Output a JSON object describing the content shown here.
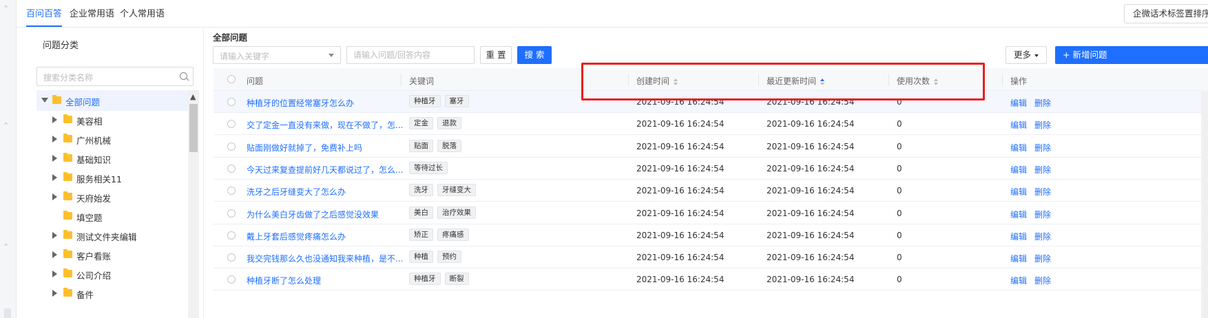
{
  "top_tabs": [
    {
      "label": "百问百答",
      "active": true
    },
    {
      "label": "企业常用语",
      "active": false
    },
    {
      "label": "个人常用语",
      "active": false
    }
  ],
  "sort_button": "企微话术标签置排序",
  "sidebar": {
    "title": "问题分类",
    "search_placeholder": "搜索分类名称",
    "tree": [
      {
        "label": "全部问题",
        "level": 0,
        "expanded": true,
        "arrow": true
      },
      {
        "label": "美容相",
        "level": 1,
        "arrow": true
      },
      {
        "label": "广州机械",
        "level": 1,
        "arrow": true
      },
      {
        "label": "基础知识",
        "level": 1,
        "arrow": true
      },
      {
        "label": "服务相关11",
        "level": 1,
        "arrow": true
      },
      {
        "label": "天府始发",
        "level": 1,
        "arrow": true
      },
      {
        "label": "填空题",
        "level": 1,
        "arrow": false
      },
      {
        "label": "测试文件夹编辑",
        "level": 1,
        "arrow": true
      },
      {
        "label": "客户看账",
        "level": 1,
        "arrow": true
      },
      {
        "label": "公司介绍",
        "level": 1,
        "arrow": true
      },
      {
        "label": "备件",
        "level": 1,
        "arrow": true
      }
    ]
  },
  "main": {
    "title": "全部问题",
    "keyword_placeholder": "请输入关键字",
    "question_placeholder": "请输入问题/回答内容",
    "reset_label": "重 置",
    "search_label": "搜 索",
    "more_label": "更多",
    "add_label": "+ 新增问题"
  },
  "table": {
    "headers": {
      "question": "问题",
      "keywords": "关键词",
      "created": "创建时间",
      "updated": "最近更新时间",
      "usage": "使用次数",
      "ops": "操作"
    },
    "edit_label": "编辑",
    "delete_label": "删除",
    "rows": [
      {
        "question": "种植牙的位置经常塞牙怎么办",
        "tags": [
          "种植牙",
          "塞牙"
        ],
        "created": "2021-09-16 16:24:54",
        "updated": "2021-09-16 16:24:54",
        "usage": "0"
      },
      {
        "question": "交了定金一直没有来做，现在不做了，怎...",
        "tags": [
          "定金",
          "退款"
        ],
        "created": "2021-09-16 16:24:54",
        "updated": "2021-09-16 16:24:54",
        "usage": "0"
      },
      {
        "question": "贴面刚做好就掉了，免费补上吗",
        "tags": [
          "贴面",
          "脱落"
        ],
        "created": "2021-09-16 16:24:54",
        "updated": "2021-09-16 16:24:54",
        "usage": "0"
      },
      {
        "question": "今天过来复查提前好几天都说过了，怎么...",
        "tags": [
          "等待过长"
        ],
        "created": "2021-09-16 16:24:54",
        "updated": "2021-09-16 16:24:54",
        "usage": "0"
      },
      {
        "question": "洗牙之后牙缝变大了怎么办",
        "tags": [
          "洗牙",
          "牙缝变大"
        ],
        "created": "2021-09-16 16:24:54",
        "updated": "2021-09-16 16:24:54",
        "usage": "0"
      },
      {
        "question": "为什么美白牙齿做了之后感觉没效果",
        "tags": [
          "美白",
          "治疗效果"
        ],
        "created": "2021-09-16 16:24:54",
        "updated": "2021-09-16 16:24:54",
        "usage": "0"
      },
      {
        "question": "戴上牙套后感觉疼痛怎么办",
        "tags": [
          "矫正",
          "疼痛感"
        ],
        "created": "2021-09-16 16:24:54",
        "updated": "2021-09-16 16:24:54",
        "usage": "0"
      },
      {
        "question": "我交完钱那么久也没通知我来种植，是不...",
        "tags": [
          "种植",
          "预约"
        ],
        "created": "2021-09-16 16:24:54",
        "updated": "2021-09-16 16:24:54",
        "usage": "0"
      },
      {
        "question": "种植牙断了怎么处理",
        "tags": [
          "种植牙",
          "断裂"
        ],
        "created": "2021-09-16 16:24:54",
        "updated": "2021-09-16 16:24:54",
        "usage": "0"
      }
    ]
  },
  "colors": {
    "accent": "#1f6fff",
    "highlight_box": "#ea1c1c",
    "folder": "#fcc02f"
  },
  "icons": [
    "search-icon",
    "folder-icon",
    "caret-right-icon",
    "caret-down-icon",
    "sort-icon",
    "chevron-down-icon",
    "chevron-up-icon"
  ]
}
